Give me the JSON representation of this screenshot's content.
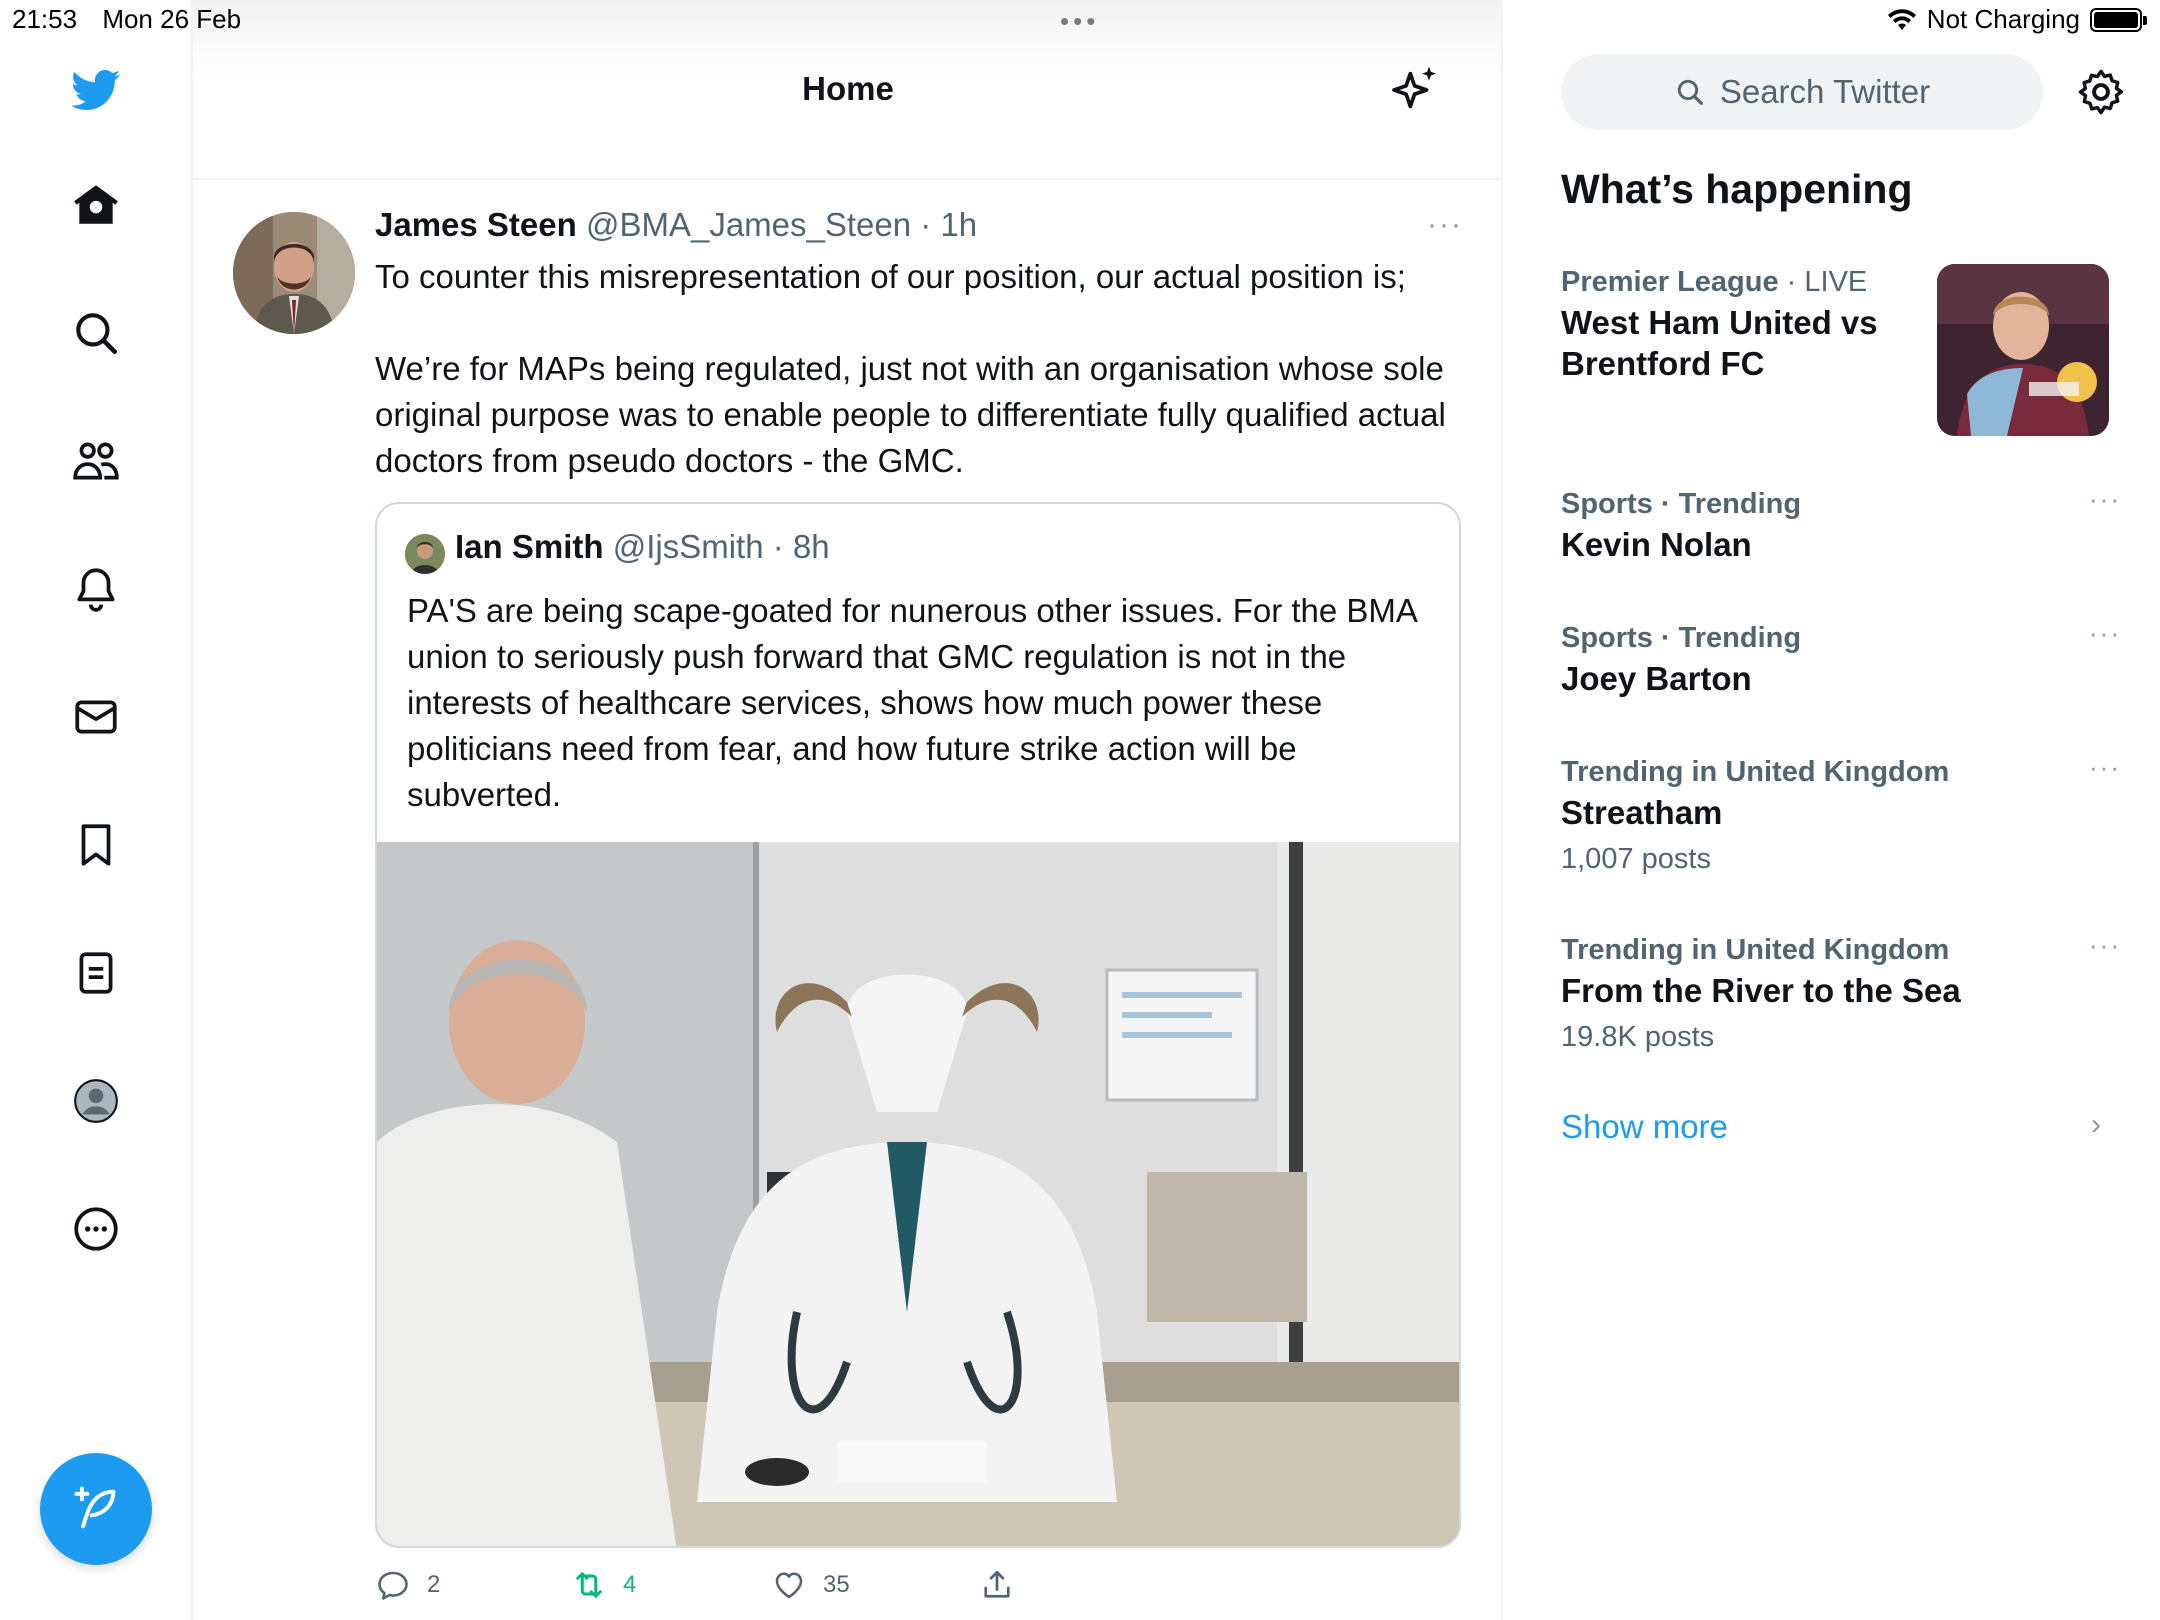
{
  "status_bar": {
    "time": "21:53",
    "date": "Mon 26 Feb",
    "battery_text": "Not Charging"
  },
  "header": {
    "title": "Home"
  },
  "tweet": {
    "author_name": "James Steen",
    "author_handle": "@BMA_James_Steen",
    "time_ago": "· 1h",
    "more": "···",
    "text_line_1": "To counter this misrepresentation of our position, our actual position is;",
    "text_paragraph_2": "We’re for MAPs being regulated, just not with an organisation whose sole original purpose was to enable people to differentiate fully qualified actual doctors from pseudo doctors - the GMC.",
    "quote": {
      "author_name": "Ian Smith",
      "author_handle": "@IjsSmith",
      "time_ago": "· 8h",
      "text": "PA'S are being scape-goated for nunerous other issues. For the BMA union to seriously push forward that GMC regulation is not in the interests of healthcare services, shows how much power these politicians need from fear, and how future strike action will be subverted."
    },
    "actions": {
      "replies": "2",
      "retweets": "4",
      "likes": "35"
    }
  },
  "sidebar_right": {
    "search_placeholder": "Search Twitter",
    "section_title": "What’s happening",
    "trends": [
      {
        "category": "Premier League",
        "live": "· LIVE",
        "title": "West Ham United vs Brentford FC",
        "count": ""
      },
      {
        "category": "Sports · Trending",
        "title": "Kevin Nolan",
        "count": ""
      },
      {
        "category": "Sports · Trending",
        "title": "Joey Barton",
        "count": ""
      },
      {
        "category": "Trending in United Kingdom",
        "title": "Streatham",
        "count": "1,007 posts"
      },
      {
        "category": "Trending in United Kingdom",
        "title": "From the River to the Sea",
        "count": "19.8K posts"
      }
    ],
    "trend_more": "···",
    "show_more": "Show more"
  },
  "colors": {
    "accent": "#1d9bf0",
    "retweet": "#00ba7c",
    "secondary_text": "#536471",
    "border": "#eff3f4"
  }
}
